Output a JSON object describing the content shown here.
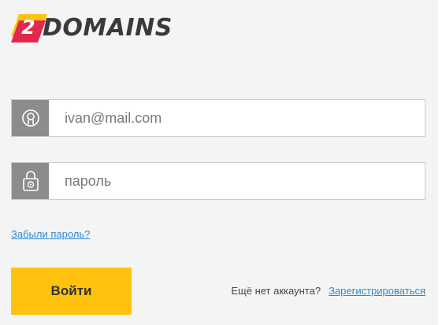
{
  "logo": {
    "digit": "2",
    "text": "DOMAINS",
    "colors": {
      "mark_red": "#e3284b",
      "mark_yellow": "#ffc20e",
      "text": "#3a3a3a"
    }
  },
  "form": {
    "email": {
      "placeholder": "ivan@mail.com",
      "icon": "user-icon"
    },
    "password": {
      "placeholder": "пароль",
      "icon": "lock-icon"
    },
    "forgot_link": "Забыли пароль?",
    "submit_label": "Войти",
    "signup_question": "Ещё нет аккаунта?",
    "signup_link": "Зарегистрироваться"
  },
  "colors": {
    "accent": "#ffc20e",
    "link": "#2a8ad4",
    "icon_bg": "#8c8c8c",
    "panel_bg": "#f4f4f4"
  }
}
